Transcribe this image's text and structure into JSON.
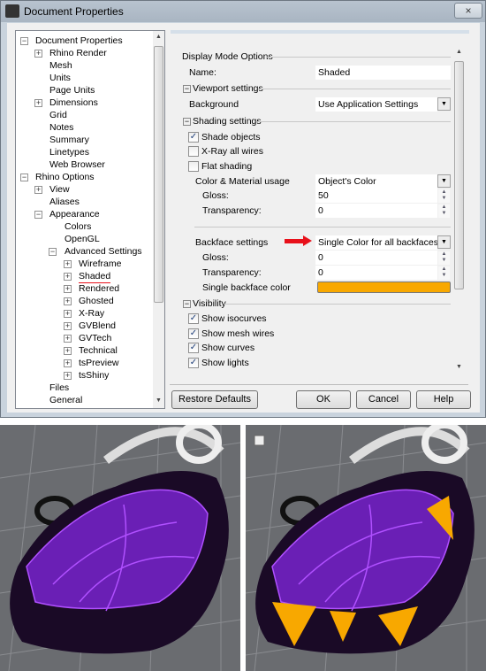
{
  "window": {
    "title": "Document Properties",
    "close_icon": "×"
  },
  "tree": {
    "items": [
      {
        "label": "Document Properties",
        "level": 0,
        "expander": "minus"
      },
      {
        "label": "Rhino Render",
        "level": 1,
        "expander": "plus"
      },
      {
        "label": "Mesh",
        "level": 1
      },
      {
        "label": "Units",
        "level": 1
      },
      {
        "label": "Page Units",
        "level": 1
      },
      {
        "label": "Dimensions",
        "level": 1,
        "expander": "plus"
      },
      {
        "label": "Grid",
        "level": 1
      },
      {
        "label": "Notes",
        "level": 1
      },
      {
        "label": "Summary",
        "level": 1
      },
      {
        "label": "Linetypes",
        "level": 1
      },
      {
        "label": "Web Browser",
        "level": 1
      },
      {
        "label": "Rhino Options",
        "level": 0,
        "expander": "minus"
      },
      {
        "label": "View",
        "level": 1,
        "expander": "plus"
      },
      {
        "label": "Aliases",
        "level": 1
      },
      {
        "label": "Appearance",
        "level": 1,
        "expander": "minus"
      },
      {
        "label": "Colors",
        "level": 2
      },
      {
        "label": "OpenGL",
        "level": 2
      },
      {
        "label": "Advanced Settings",
        "level": 2,
        "expander": "minus"
      },
      {
        "label": "Wireframe",
        "level": 3,
        "expander": "plus"
      },
      {
        "label": "Shaded",
        "level": 3,
        "expander": "plus",
        "underlined": true
      },
      {
        "label": "Rendered",
        "level": 3,
        "expander": "plus"
      },
      {
        "label": "Ghosted",
        "level": 3,
        "expander": "plus"
      },
      {
        "label": "X-Ray",
        "level": 3,
        "expander": "plus"
      },
      {
        "label": "GVBlend",
        "level": 3,
        "expander": "plus"
      },
      {
        "label": "GVTech",
        "level": 3,
        "expander": "plus"
      },
      {
        "label": "Technical",
        "level": 3,
        "expander": "plus"
      },
      {
        "label": "tsPreview",
        "level": 3,
        "expander": "plus"
      },
      {
        "label": "tsShiny",
        "level": 3,
        "expander": "plus"
      },
      {
        "label": "Files",
        "level": 1
      },
      {
        "label": "General",
        "level": 1
      }
    ]
  },
  "settings": {
    "display_mode_options": "Display Mode Options",
    "name_label": "Name:",
    "name_value": "Shaded",
    "viewport_settings": "Viewport settings",
    "background_label": "Background",
    "background_value": "Use Application Settings",
    "shading_settings": "Shading settings",
    "shade_objects": {
      "label": "Shade objects",
      "checked": true
    },
    "xray_all_wires": {
      "label": "X-Ray all wires",
      "checked": false
    },
    "flat_shading": {
      "label": "Flat shading",
      "checked": false
    },
    "color_material_label": "Color & Material usage",
    "color_material_value": "Object's Color",
    "gloss_label": "Gloss:",
    "gloss_value": "50",
    "transparency_label": "Transparency:",
    "transparency_value": "0",
    "backface_label": "Backface settings",
    "backface_value": "Single Color for all backfaces",
    "backface_gloss_label": "Gloss:",
    "backface_gloss_value": "0",
    "backface_transparency_label": "Transparency:",
    "backface_transparency_value": "0",
    "single_backface_color_label": "Single backface color",
    "single_backface_color": "#f8a800",
    "visibility": "Visibility",
    "show_isocurves": {
      "label": "Show isocurves",
      "checked": true
    },
    "show_mesh_wires": {
      "label": "Show mesh wires",
      "checked": true
    },
    "show_curves": {
      "label": "Show curves",
      "checked": true
    },
    "show_lights": {
      "label": "Show lights",
      "checked": true
    }
  },
  "buttons": {
    "restore_defaults": "Restore Defaults",
    "ok": "OK",
    "cancel": "Cancel",
    "help": "Help"
  },
  "colors": {
    "annotation_red": "#e8101a",
    "object_purple": "#6a1fb5",
    "wire_purple": "#b050ff",
    "backface_orange": "#f8a800"
  }
}
